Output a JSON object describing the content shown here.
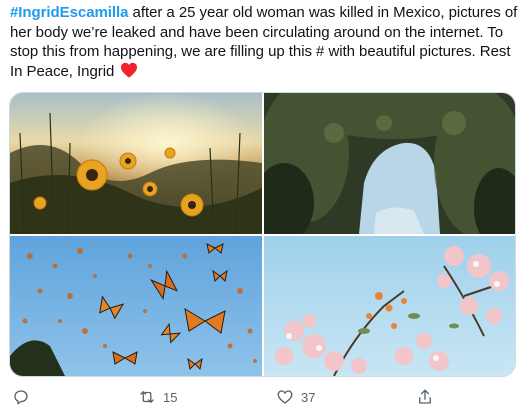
{
  "tweet": {
    "hashtag": "#IngridEscamilla",
    "line1_rest": " after a 25 year old woman was killed in Mexico, pictures of her body we’re leaked and have been circulating around on the internet. To stop this from happening, we are filling up this # with beautiful pictures. Rest In Peace, Ingrid",
    "heart_icon": "red-heart-emoji"
  },
  "media": {
    "images": [
      {
        "name": "sunflowers-sunset-photo"
      },
      {
        "name": "cave-arch-sky-photo"
      },
      {
        "name": "monarch-butterflies-photo"
      },
      {
        "name": "blossom-branches-photo"
      }
    ]
  },
  "actions": {
    "reply_icon": "reply-icon",
    "retweet_icon": "retweet-icon",
    "retweet_count": "15",
    "like_icon": "heart-icon",
    "like_count": "37",
    "share_icon": "share-icon"
  },
  "colors": {
    "accent": "#1d9bf0",
    "heart": "#f4212e",
    "muted": "#536471"
  }
}
